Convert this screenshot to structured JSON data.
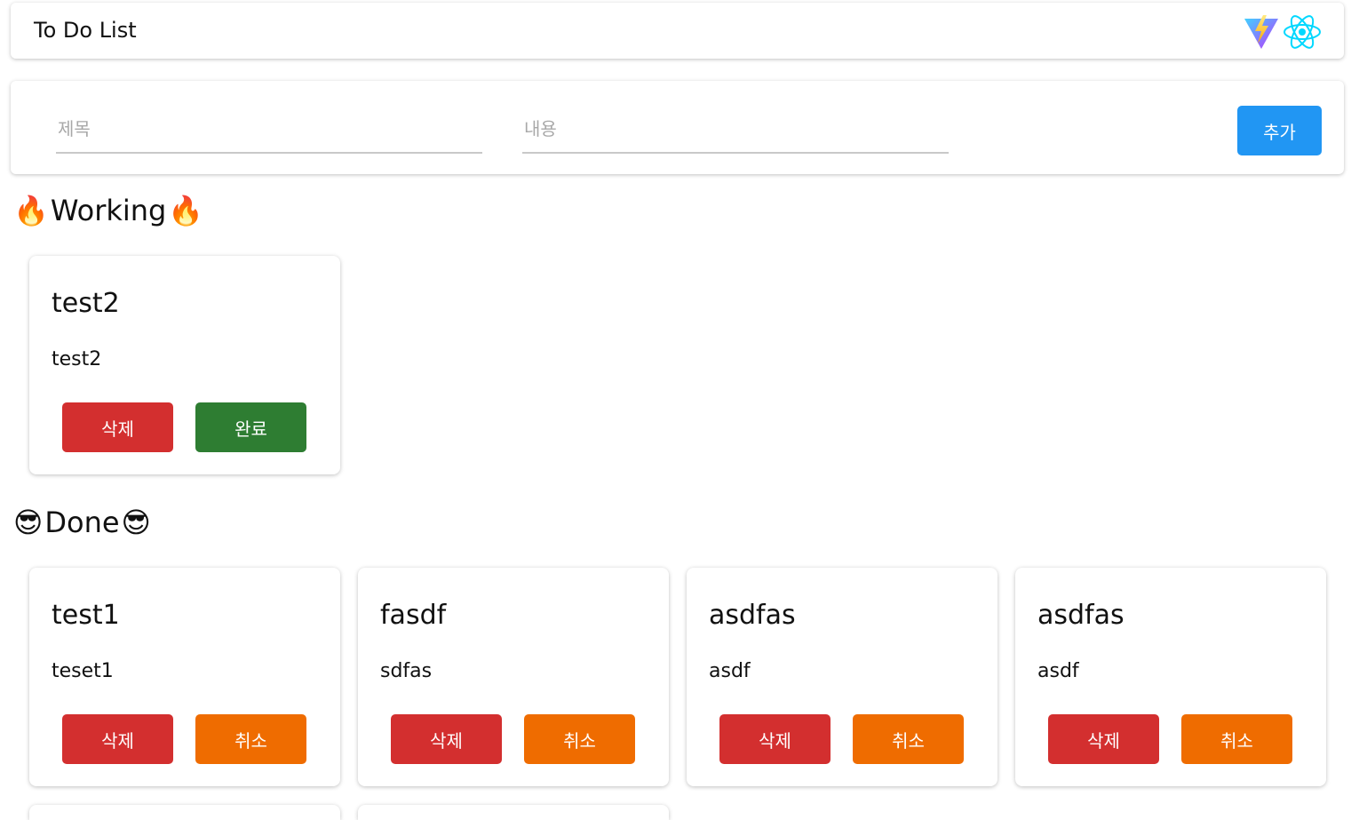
{
  "header": {
    "title": "To Do List",
    "logos": [
      "vite-logo",
      "react-logo"
    ]
  },
  "form": {
    "title_placeholder": "제목",
    "content_placeholder": "내용",
    "add_label": "추가"
  },
  "working": {
    "title": "Working",
    "emoji": "🔥",
    "cards": [
      {
        "title": "test2",
        "body": "test2",
        "delete_label": "삭제",
        "action_label": "완료"
      }
    ]
  },
  "done": {
    "title": "Done",
    "emoji": "😎",
    "cards": [
      {
        "title": "test1",
        "body": "teset1",
        "delete_label": "삭제",
        "action_label": "취소"
      },
      {
        "title": "fasdf",
        "body": "sdfas",
        "delete_label": "삭제",
        "action_label": "취소"
      },
      {
        "title": "asdfas",
        "body": "asdf",
        "delete_label": "삭제",
        "action_label": "취소"
      },
      {
        "title": "asdfas",
        "body": "asdf",
        "delete_label": "삭제",
        "action_label": "취소"
      }
    ]
  },
  "colors": {
    "add": "#2196f3",
    "delete": "#d32f2f",
    "complete": "#2e7d32",
    "cancel": "#ef6c00"
  }
}
